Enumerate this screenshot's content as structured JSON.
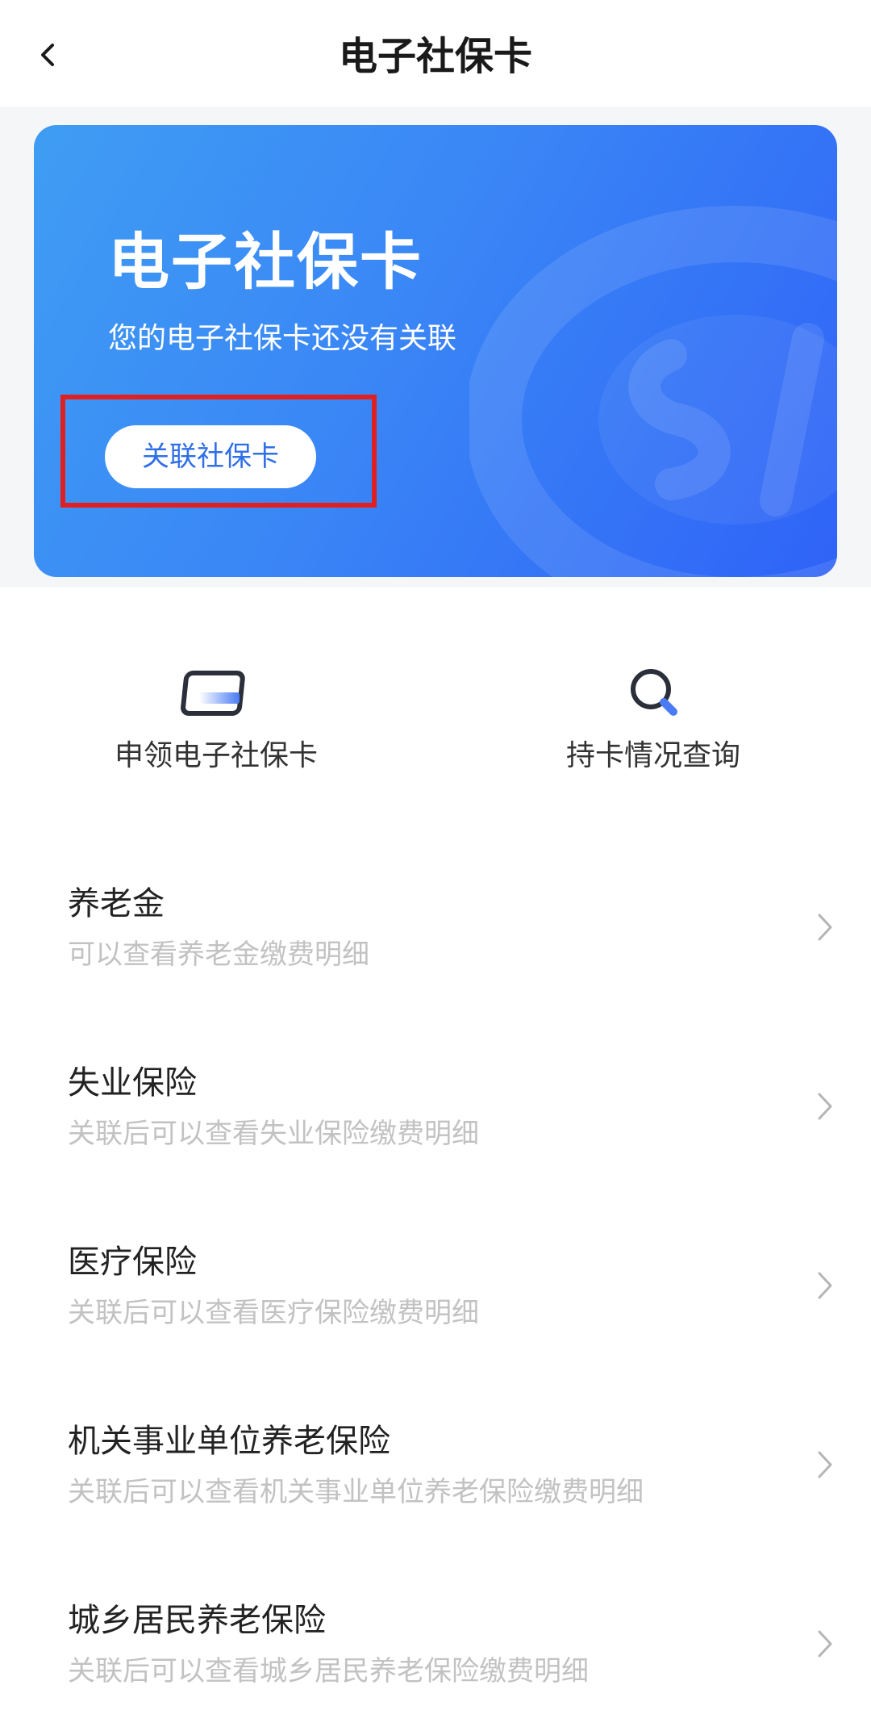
{
  "header": {
    "title": "电子社保卡",
    "back_icon": "chevron-left-icon"
  },
  "card": {
    "title": "电子社保卡",
    "subtitle": "您的电子社保卡还没有关联",
    "button_label": "关联社保卡"
  },
  "quick_actions": [
    {
      "label": "申领电子社保卡",
      "icon": "card-icon"
    },
    {
      "label": "持卡情况查询",
      "icon": "search-icon"
    }
  ],
  "items": [
    {
      "title": "养老金",
      "desc": "可以查看养老金缴费明细"
    },
    {
      "title": "失业保险",
      "desc": "关联后可以查看失业保险缴费明细"
    },
    {
      "title": "医疗保险",
      "desc": "关联后可以查看医疗保险缴费明细"
    },
    {
      "title": "机关事业单位养老保险",
      "desc": "关联后可以查看机关事业单位养老保险缴费明细"
    },
    {
      "title": "城乡居民养老保险",
      "desc": "关联后可以查看城乡居民养老保险缴费明细"
    }
  ],
  "colors": {
    "card_gradient_start": "#3f9df3",
    "card_gradient_end": "#2f63f7",
    "highlight_border": "#e02020",
    "button_text": "#2f6fe8",
    "secondary_text": "#c2c2c2"
  }
}
